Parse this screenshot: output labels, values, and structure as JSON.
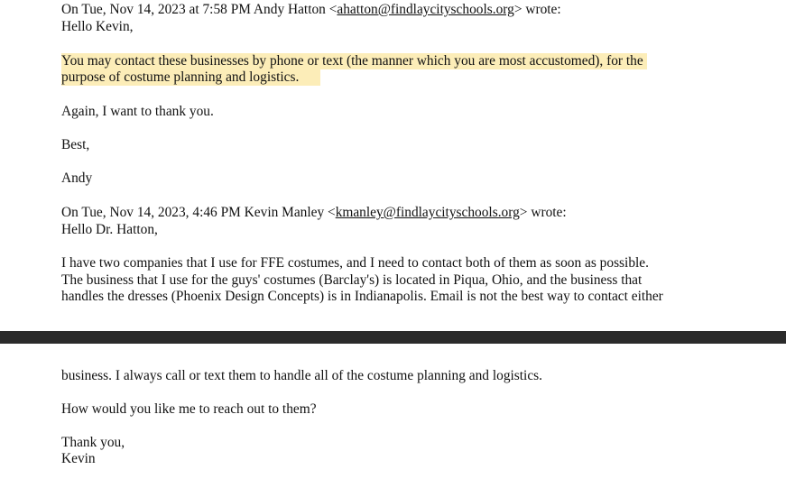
{
  "email": {
    "quote1_header": {
      "prefix": "On Tue, Nov 14, 2023 at 7:58 PM Andy Hatton <",
      "address": "ahatton@findlaycityschools.org",
      "suffix": "> wrote:"
    },
    "andy_greeting": "Hello Kevin,",
    "andy_highlight_line1": "You may contact these businesses by phone or text (the manner which you are most accustomed), for the",
    "andy_highlight_line2": "purpose of costume planning and logistics.",
    "andy_thanks": "Again, I want to thank you.",
    "andy_signoff": "Best,",
    "andy_name": "Andy",
    "quote2_header": {
      "prefix": "On Tue, Nov 14, 2023, 4:46 PM Kevin Manley <",
      "address": "kmanley@findlaycityschools.org",
      "suffix": "> wrote:"
    },
    "kevin_greeting": "Hello Dr. Hatton,",
    "kevin_body_line1": "I have two companies that I use for FFE costumes, and I need to contact both of them as soon as possible.",
    "kevin_body_line2": "The business that I use for the guys' costumes (Barclay's) is located in Piqua, Ohio, and the business that",
    "kevin_body_line3": "handles the dresses (Phoenix Design Concepts) is in Indianapolis.  Email is not the best way to contact either",
    "kevin_body_line4": "business.  I always call or text them to handle all of the costume planning and logistics.",
    "kevin_question": "How would you like me to reach out to them?",
    "kevin_signoff": "Thank you,",
    "kevin_name": "Kevin"
  },
  "colors": {
    "highlight": "#fcedb8",
    "page_gap": "#2b2b2b"
  }
}
